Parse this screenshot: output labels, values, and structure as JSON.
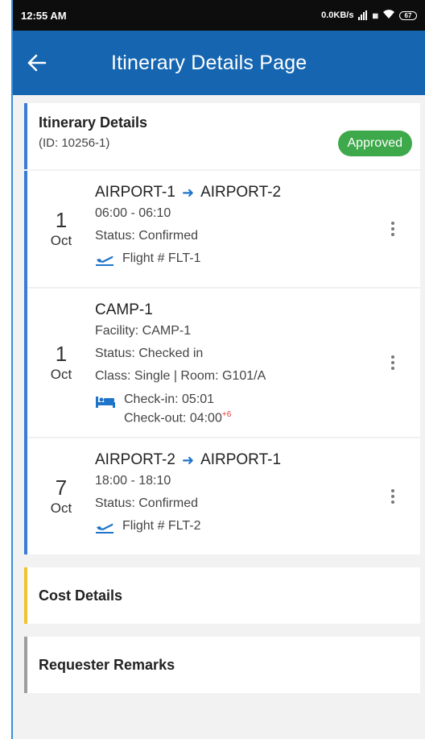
{
  "status_bar": {
    "time": "12:55 AM",
    "network_speed": "0.0KB/s",
    "battery_level": "67"
  },
  "header": {
    "title": "Itinerary Details Page",
    "back_icon": "arrow-left-icon"
  },
  "summary": {
    "title": "Itinerary Details",
    "id_text": "(ID: 10256-1)",
    "status_badge": "Approved",
    "badge_color": "#3ea94b"
  },
  "items": [
    {
      "type": "flight",
      "day": "1",
      "month": "Oct",
      "from": "AIRPORT-1",
      "to": "AIRPORT-2",
      "time": "06:00 - 06:10",
      "status": "Status: Confirmed",
      "flight": "Flight # FLT-1"
    },
    {
      "type": "hotel",
      "day": "1",
      "month": "Oct",
      "name": "CAMP-1",
      "facility": "Facility: CAMP-1",
      "status": "Status: Checked in",
      "class_room": "Class: Single | Room: G101/A",
      "checkin": "Check-in: 05:01",
      "checkout": "Check-out: 04:00",
      "checkout_extra": "+6"
    },
    {
      "type": "flight",
      "day": "7",
      "month": "Oct",
      "from": "AIRPORT-2",
      "to": "AIRPORT-1",
      "time": "18:00 - 18:10",
      "status": "Status: Confirmed",
      "flight": "Flight # FLT-2"
    }
  ],
  "sections": {
    "cost": "Cost Details",
    "remarks": "Requester Remarks"
  },
  "colors": {
    "appbar": "#1565b0",
    "accent_blue": "#3a7bd5",
    "cost_accent": "#f2c230",
    "remarks_accent": "#9e9e9e"
  }
}
